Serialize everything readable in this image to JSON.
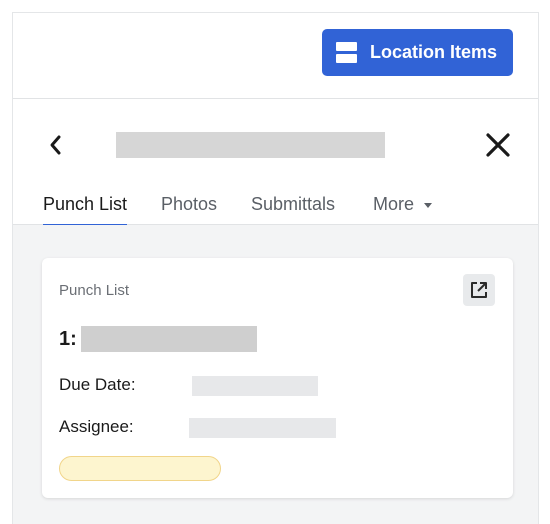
{
  "toolbar": {
    "location_items_label": "Location Items"
  },
  "tabs": [
    {
      "label": "Punch List",
      "active": true
    },
    {
      "label": "Photos",
      "active": false
    },
    {
      "label": "Submittals",
      "active": false
    },
    {
      "label": "More",
      "active": false
    }
  ],
  "card": {
    "heading": "Punch List",
    "item_number": "1:",
    "due_date_label": "Due Date:",
    "assignee_label": "Assignee:"
  },
  "icons": {
    "location": "location-items-icon",
    "back": "chevron-left-icon",
    "close": "close-icon",
    "open": "external-link-icon",
    "more": "caret-down-icon"
  },
  "colors": {
    "accent": "#3163d6",
    "badge_bg": "#fdf5cf",
    "badge_border": "#f1d58a"
  }
}
